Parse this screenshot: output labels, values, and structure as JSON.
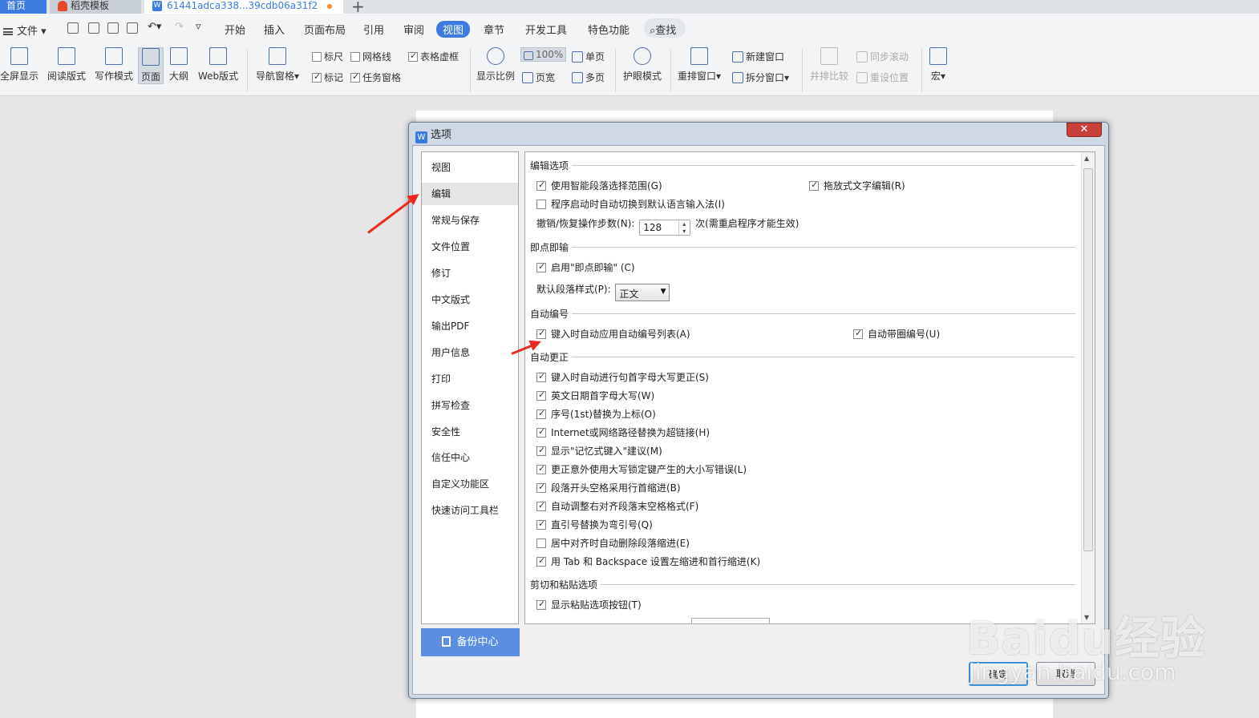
{
  "tabs": {
    "home": "首页",
    "template": "稻壳模板",
    "document": "61441adca338...39cdb06a31f2"
  },
  "menu": {
    "file": "文件",
    "items": [
      "开始",
      "插入",
      "页面布局",
      "引用",
      "审阅",
      "视图",
      "章节",
      "开发工具",
      "特色功能"
    ],
    "active": "视图",
    "search": "查找"
  },
  "ribbon": {
    "buttons": [
      "全屏显示",
      "阅读版式",
      "写作模式",
      "页面",
      "大纲",
      "Web版式",
      "导航窗格",
      "显示比例",
      "护眼模式",
      "重排窗口",
      "拆分窗口",
      "并排比较",
      "宏"
    ],
    "checks": {
      "ruler": "标尺",
      "gridlines": "网格线",
      "table_gridlines": "表格虚框",
      "marks": "标记",
      "task_pane": "任务窗格"
    },
    "zoom": "100%",
    "page_width": "页宽",
    "single_page": "单页",
    "multi_page": "多页",
    "new_window": "新建窗口",
    "sync_scroll": "同步滚动",
    "reset_position": "重设位置"
  },
  "dialog": {
    "title": "选项",
    "nav": [
      "视图",
      "编辑",
      "常规与保存",
      "文件位置",
      "修订",
      "中文版式",
      "输出PDF",
      "用户信息",
      "打印",
      "拼写检查",
      "安全性",
      "信任中心",
      "自定义功能区",
      "快速访问工具栏"
    ],
    "nav_selected": "编辑",
    "backup": "备份中心",
    "sections": {
      "editing": "编辑选项",
      "click_type": "即点即输",
      "auto_numbering": "自动编号",
      "auto_correct": "自动更正",
      "cut_paste": "剪切和粘贴选项"
    },
    "options": {
      "smart_para": "使用智能段落选择范围(G)",
      "drag_drop": "拖放式文字编辑(R)",
      "auto_ime": "程序启动时自动切换到默认语言输入法(I)",
      "undo_label": "撤销/恢复操作步数(N):",
      "undo_value": "128",
      "undo_note": "次(需重启程序才能生效)",
      "enable_click_type": "启用\"即点即输\" (C)",
      "default_style_label": "默认段落样式(P):",
      "default_style_value": "正文",
      "auto_list": "键入时自动应用自动编号列表(A)",
      "auto_circle": "自动带圈编号(U)",
      "ac_items": [
        "键入时自动进行句首字母大写更正(S)",
        "英文日期首字母大写(W)",
        "序号(1st)替换为上标(O)",
        "Internet或网络路径替换为超链接(H)",
        "显示\"记忆式键入\"建议(M)",
        "更正意外使用大写锁定键产生的大小写错误(L)",
        "段落开头空格采用行首缩进(B)",
        "自动调整右对齐段落末空格格式(F)",
        "直引号替换为弯引号(Q)",
        "居中对齐时自动删除段落缩进(E)",
        "用 Tab 和 Backspace 设置左缩进和首行缩进(K)"
      ],
      "show_paste_btn": "显示粘贴选项按钮(T)"
    },
    "ok": "确定",
    "cancel": "取消"
  },
  "watermark": {
    "logo": "Baidu经验",
    "url": "jingyan.baidu.com"
  }
}
